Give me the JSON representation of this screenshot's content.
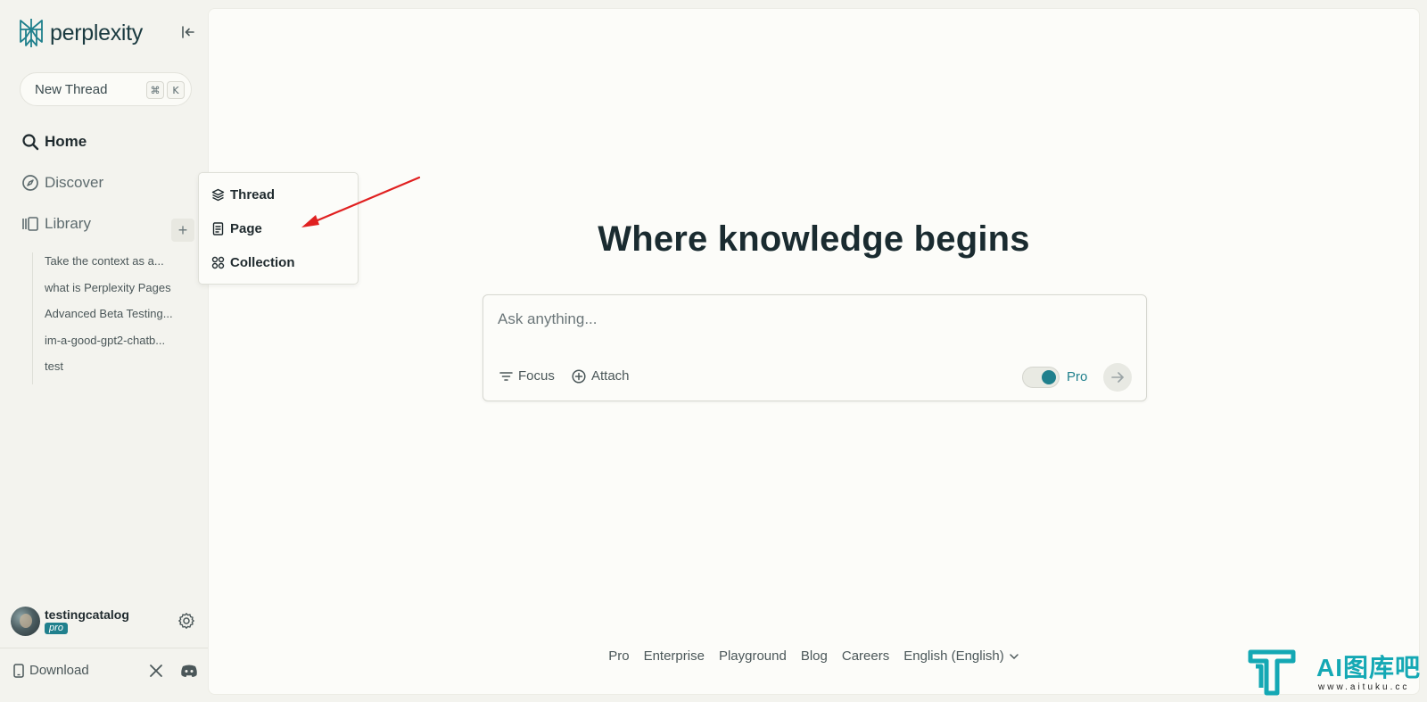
{
  "app": {
    "logo_text": "perplexity"
  },
  "sidebar": {
    "new_thread": {
      "label": "New Thread",
      "shortcut_cmd": "⌘",
      "shortcut_key": "K"
    },
    "nav": [
      {
        "label": "Home",
        "icon": "search-icon"
      },
      {
        "label": "Discover",
        "icon": "compass-icon"
      },
      {
        "label": "Library",
        "icon": "library-icon"
      }
    ],
    "library_add": "+",
    "library_items": [
      "Take the context as a...",
      "what is Perplexity Pages",
      "Advanced Beta Testing...",
      "im-a-good-gpt2-chatb...",
      "test"
    ],
    "user": {
      "name": "testingcatalog",
      "badge": "pro"
    },
    "download_label": "Download"
  },
  "menu": {
    "items": [
      {
        "label": "Thread",
        "icon": "layers-icon"
      },
      {
        "label": "Page",
        "icon": "page-icon"
      },
      {
        "label": "Collection",
        "icon": "grid-icon"
      }
    ]
  },
  "main": {
    "hero_title": "Where knowledge begins",
    "ask": {
      "placeholder": "Ask anything...",
      "focus_label": "Focus",
      "attach_label": "Attach",
      "pro_label": "Pro",
      "pro_enabled": true
    },
    "footer_links": [
      "Pro",
      "Enterprise",
      "Playground",
      "Blog",
      "Careers",
      "English (English)"
    ]
  },
  "watermark": {
    "text": "AI图库吧",
    "url": "www.aituku.cc"
  },
  "colors": {
    "accent": "#20808d",
    "arrow": "#e02020",
    "background": "#f3f3ee",
    "panel": "#fcfcf9",
    "watermark": "#14a8b4"
  }
}
